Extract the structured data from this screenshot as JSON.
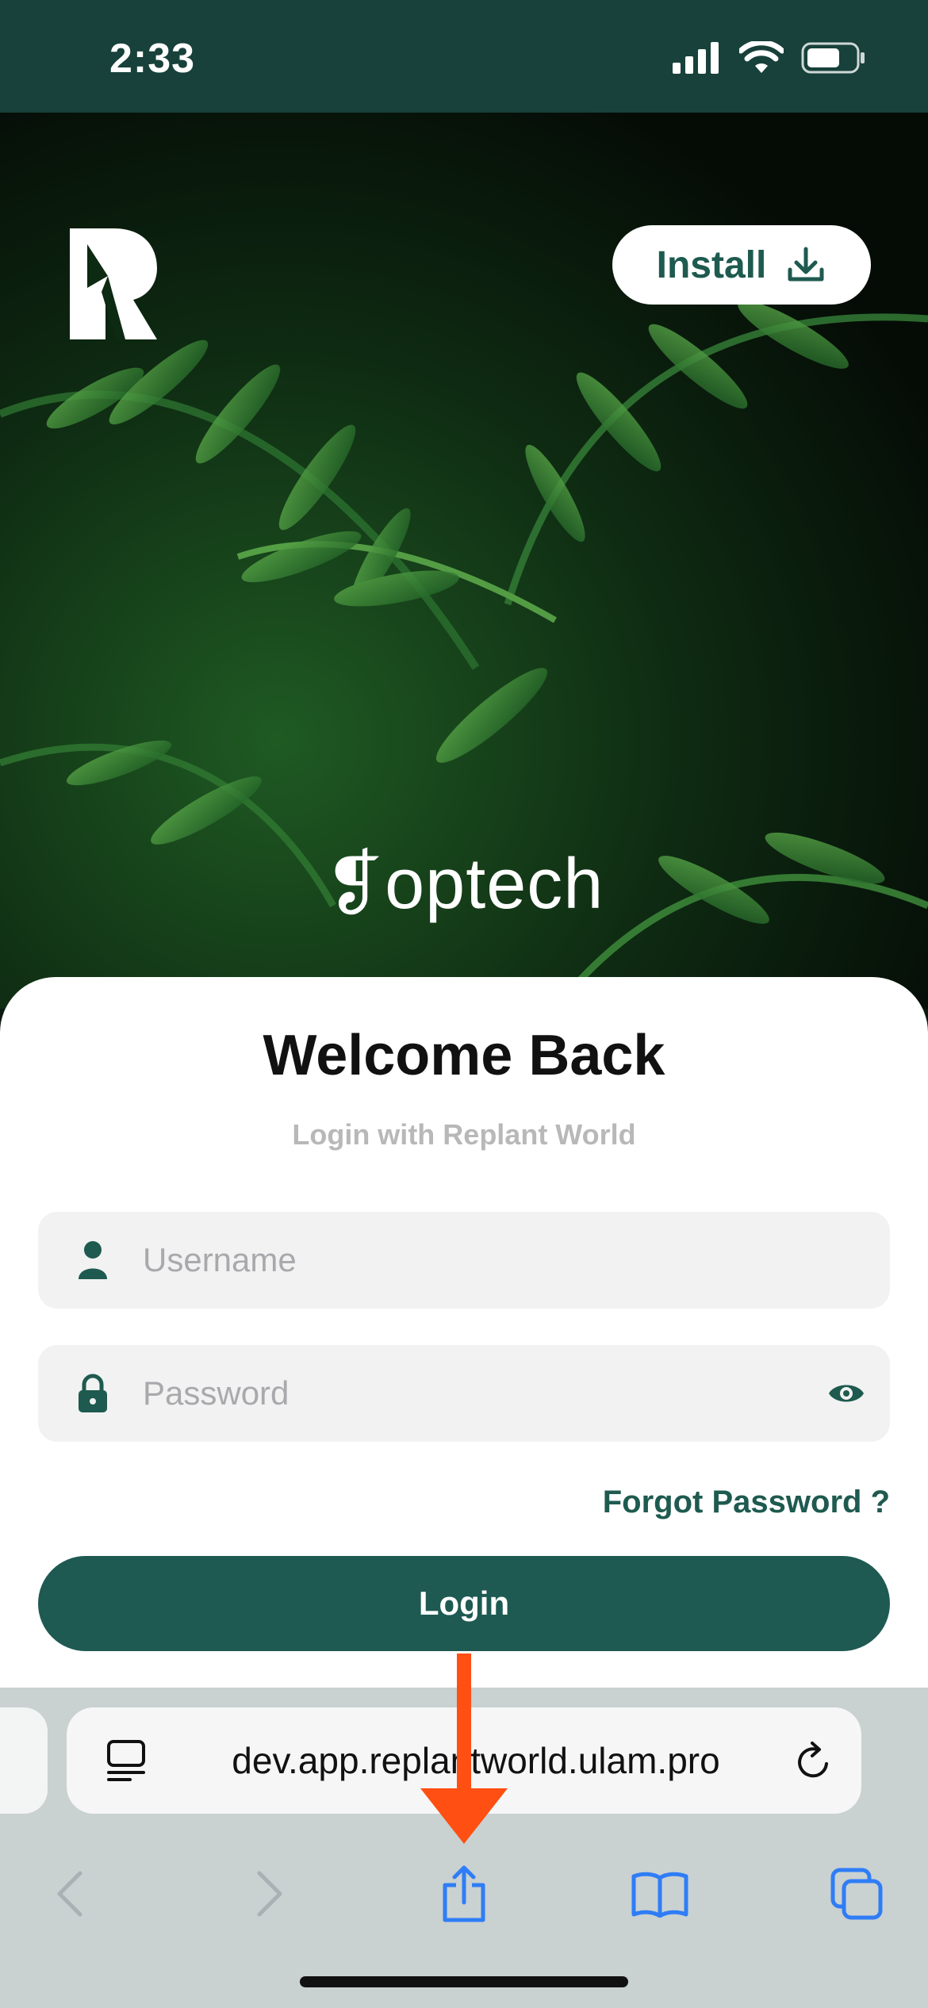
{
  "status_bar": {
    "time": "2:33"
  },
  "header": {
    "install_label": "Install"
  },
  "hero": {
    "brand": "optech"
  },
  "login": {
    "title": "Welcome Back",
    "subtitle": "Login with Replant World",
    "username_placeholder": "Username",
    "password_placeholder": "Password",
    "forgot_label": "Forgot Password ?",
    "login_label": "Login"
  },
  "browser": {
    "url": "dev.app.replantworld.ulam.pro"
  },
  "colors": {
    "primary": "#1e5a52",
    "status_bar": "#17413a",
    "toolbar": "#c9d1d1",
    "ios_blue": "#2f7df6",
    "annotation_arrow": "#ff4f12"
  }
}
